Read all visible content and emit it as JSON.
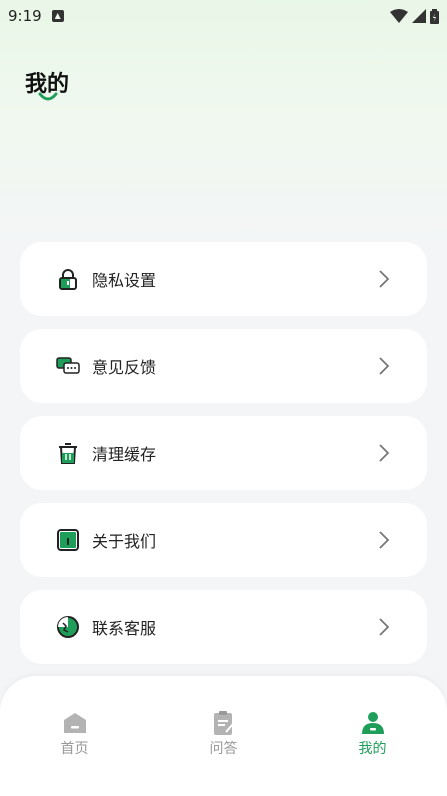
{
  "status_bar": {
    "time": "9:19"
  },
  "page": {
    "title": "我的"
  },
  "menu": {
    "items": [
      {
        "label": "隐私设置",
        "icon": "lock-icon"
      },
      {
        "label": "意见反馈",
        "icon": "chat-bubbles-icon"
      },
      {
        "label": "清理缓存",
        "icon": "trash-icon"
      },
      {
        "label": "关于我们",
        "icon": "info-card-icon"
      },
      {
        "label": "联系客服",
        "icon": "headset-icon"
      }
    ]
  },
  "tabbar": {
    "tabs": [
      {
        "label": "首页",
        "icon": "home-icon",
        "active": false
      },
      {
        "label": "问答",
        "icon": "clipboard-icon",
        "active": false
      },
      {
        "label": "我的",
        "icon": "user-icon",
        "active": true
      }
    ]
  },
  "colors": {
    "accent": "#1f9e5a",
    "inactive": "#999999"
  }
}
